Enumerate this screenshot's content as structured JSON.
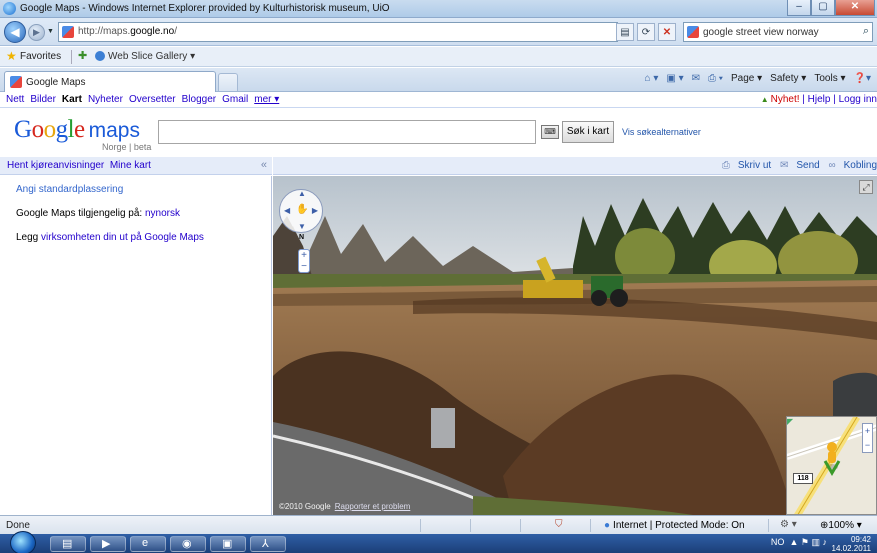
{
  "browser": {
    "title": "Google Maps - Windows Internet Explorer provided by Kulturhistorisk museum, UiO",
    "url_prefix": "http://maps.",
    "url_domain": "google.no",
    "url_suffix": "/",
    "search_query": "google street view norway",
    "favorites_label": "Favorites",
    "web_slice_gallery": "Web Slice Gallery",
    "tab_label": "Google Maps",
    "commands": {
      "page": "Page",
      "safety": "Safety",
      "tools": "Tools"
    }
  },
  "google_bar": {
    "links": [
      "Nett",
      "Bilder",
      "Kart",
      "Nyheter",
      "Oversetter",
      "Blogger",
      "Gmail"
    ],
    "active": "Kart",
    "more": "mer ▾",
    "new": "Nyhet!",
    "help": "Hjelp",
    "login": "Logg inn"
  },
  "maps_header": {
    "logo_word": "Google",
    "logo_maps": "maps",
    "logo_sub": "Norge | beta",
    "search_button": "Søk i kart",
    "search_options": "Vis søkealternativer"
  },
  "left_panel": {
    "directions": "Hent kjøreanvisninger",
    "my_maps": "Mine kart",
    "collapse": "«",
    "set_default": "Angi standardplassering",
    "available_prefix": "Google Maps tilgjengelig på: ",
    "available_link": "nynorsk",
    "business_prefix": "Legg ",
    "business_link": "virksomheten din ut på Google Maps"
  },
  "map_actions": {
    "print": "Skriv ut",
    "send": "Send",
    "link": "Kobling"
  },
  "street_view": {
    "copyright": "©2010 Google",
    "report": "Rapporter et problem",
    "compass_n": "N",
    "route_shield": "118"
  },
  "status_bar": {
    "text": "Done",
    "zone": "Internet | Protected Mode: On",
    "zoom": "100%"
  },
  "taskbar": {
    "lang": "NO",
    "time": "09:42",
    "date": "14.02.2011"
  }
}
